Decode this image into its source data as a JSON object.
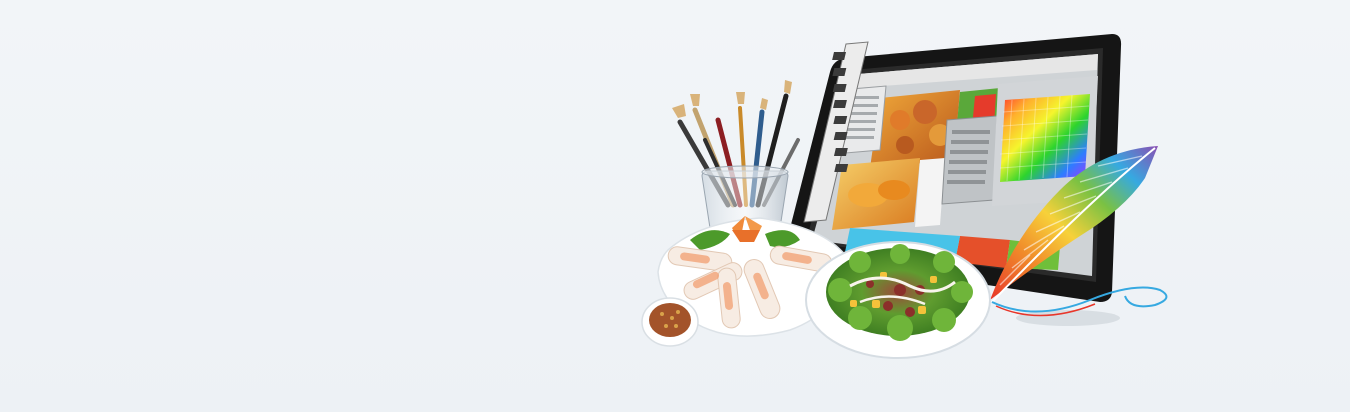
{
  "banner": {
    "illustration": {
      "subject": "graphic-design-and-food",
      "icons": [
        "tablet-photo-editor-icon",
        "brush-cup-icon",
        "feather-icon",
        "spring-rolls-plate-icon",
        "salad-plate-icon",
        "dipping-sauce-icon"
      ]
    }
  },
  "colors": {
    "background": "#eff3f7",
    "tablet_frame": "#151515",
    "editor_ui": "#d8d8d8",
    "feather_red": "#e8362a",
    "feather_yellow": "#f7d13a",
    "feather_blue": "#36a9e1"
  }
}
